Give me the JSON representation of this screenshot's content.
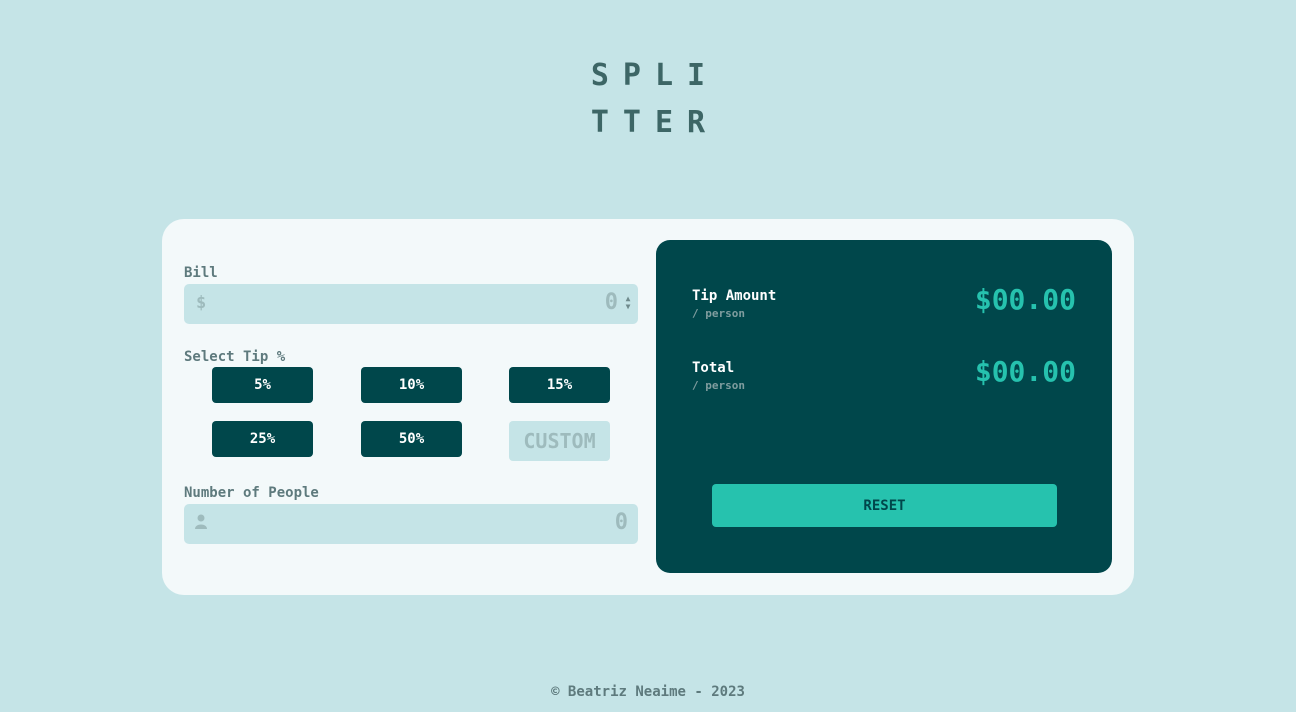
{
  "header": {
    "logo_line1": "SPLI",
    "logo_line2": "TTER"
  },
  "calculator": {
    "bill": {
      "label": "Bill",
      "prefix": "$",
      "placeholder": "0"
    },
    "tip": {
      "label": "Select Tip %",
      "options": [
        "5%",
        "10%",
        "15%",
        "25%",
        "50%"
      ],
      "custom_placeholder": "CUSTOM"
    },
    "people": {
      "label": "Number of People",
      "placeholder": "0"
    }
  },
  "results": {
    "tip_amount": {
      "title": "Tip Amount",
      "sub": "/ person",
      "value": "$00.00"
    },
    "total": {
      "title": "Total",
      "sub": "/ person",
      "value": "$00.00"
    },
    "reset_label": "RESET"
  },
  "footer": {
    "text": "© Beatriz Neaime - 2023"
  },
  "colors": {
    "background": "#c5e4e7",
    "card": "#f3f9fa",
    "dark_cyan": "#00474b",
    "strong_cyan": "#26c2ae"
  }
}
